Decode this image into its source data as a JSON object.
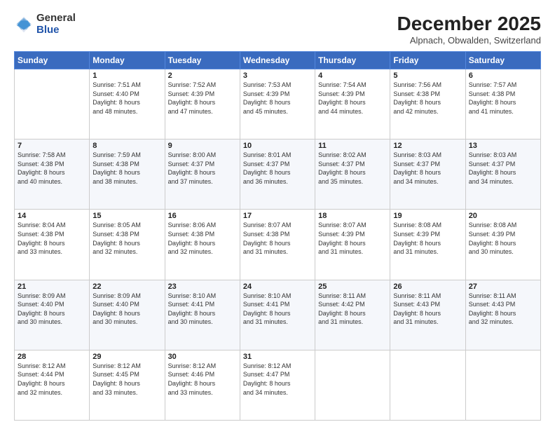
{
  "logo": {
    "general": "General",
    "blue": "Blue"
  },
  "title": "December 2025",
  "subtitle": "Alpnach, Obwalden, Switzerland",
  "weekdays": [
    "Sunday",
    "Monday",
    "Tuesday",
    "Wednesday",
    "Thursday",
    "Friday",
    "Saturday"
  ],
  "weeks": [
    [
      {
        "day": "",
        "info": ""
      },
      {
        "day": "1",
        "info": "Sunrise: 7:51 AM\nSunset: 4:40 PM\nDaylight: 8 hours\nand 48 minutes."
      },
      {
        "day": "2",
        "info": "Sunrise: 7:52 AM\nSunset: 4:39 PM\nDaylight: 8 hours\nand 47 minutes."
      },
      {
        "day": "3",
        "info": "Sunrise: 7:53 AM\nSunset: 4:39 PM\nDaylight: 8 hours\nand 45 minutes."
      },
      {
        "day": "4",
        "info": "Sunrise: 7:54 AM\nSunset: 4:39 PM\nDaylight: 8 hours\nand 44 minutes."
      },
      {
        "day": "5",
        "info": "Sunrise: 7:56 AM\nSunset: 4:38 PM\nDaylight: 8 hours\nand 42 minutes."
      },
      {
        "day": "6",
        "info": "Sunrise: 7:57 AM\nSunset: 4:38 PM\nDaylight: 8 hours\nand 41 minutes."
      }
    ],
    [
      {
        "day": "7",
        "info": "Sunrise: 7:58 AM\nSunset: 4:38 PM\nDaylight: 8 hours\nand 40 minutes."
      },
      {
        "day": "8",
        "info": "Sunrise: 7:59 AM\nSunset: 4:38 PM\nDaylight: 8 hours\nand 38 minutes."
      },
      {
        "day": "9",
        "info": "Sunrise: 8:00 AM\nSunset: 4:37 PM\nDaylight: 8 hours\nand 37 minutes."
      },
      {
        "day": "10",
        "info": "Sunrise: 8:01 AM\nSunset: 4:37 PM\nDaylight: 8 hours\nand 36 minutes."
      },
      {
        "day": "11",
        "info": "Sunrise: 8:02 AM\nSunset: 4:37 PM\nDaylight: 8 hours\nand 35 minutes."
      },
      {
        "day": "12",
        "info": "Sunrise: 8:03 AM\nSunset: 4:37 PM\nDaylight: 8 hours\nand 34 minutes."
      },
      {
        "day": "13",
        "info": "Sunrise: 8:03 AM\nSunset: 4:37 PM\nDaylight: 8 hours\nand 34 minutes."
      }
    ],
    [
      {
        "day": "14",
        "info": "Sunrise: 8:04 AM\nSunset: 4:38 PM\nDaylight: 8 hours\nand 33 minutes."
      },
      {
        "day": "15",
        "info": "Sunrise: 8:05 AM\nSunset: 4:38 PM\nDaylight: 8 hours\nand 32 minutes."
      },
      {
        "day": "16",
        "info": "Sunrise: 8:06 AM\nSunset: 4:38 PM\nDaylight: 8 hours\nand 32 minutes."
      },
      {
        "day": "17",
        "info": "Sunrise: 8:07 AM\nSunset: 4:38 PM\nDaylight: 8 hours\nand 31 minutes."
      },
      {
        "day": "18",
        "info": "Sunrise: 8:07 AM\nSunset: 4:39 PM\nDaylight: 8 hours\nand 31 minutes."
      },
      {
        "day": "19",
        "info": "Sunrise: 8:08 AM\nSunset: 4:39 PM\nDaylight: 8 hours\nand 31 minutes."
      },
      {
        "day": "20",
        "info": "Sunrise: 8:08 AM\nSunset: 4:39 PM\nDaylight: 8 hours\nand 30 minutes."
      }
    ],
    [
      {
        "day": "21",
        "info": "Sunrise: 8:09 AM\nSunset: 4:40 PM\nDaylight: 8 hours\nand 30 minutes."
      },
      {
        "day": "22",
        "info": "Sunrise: 8:09 AM\nSunset: 4:40 PM\nDaylight: 8 hours\nand 30 minutes."
      },
      {
        "day": "23",
        "info": "Sunrise: 8:10 AM\nSunset: 4:41 PM\nDaylight: 8 hours\nand 30 minutes."
      },
      {
        "day": "24",
        "info": "Sunrise: 8:10 AM\nSunset: 4:41 PM\nDaylight: 8 hours\nand 31 minutes."
      },
      {
        "day": "25",
        "info": "Sunrise: 8:11 AM\nSunset: 4:42 PM\nDaylight: 8 hours\nand 31 minutes."
      },
      {
        "day": "26",
        "info": "Sunrise: 8:11 AM\nSunset: 4:43 PM\nDaylight: 8 hours\nand 31 minutes."
      },
      {
        "day": "27",
        "info": "Sunrise: 8:11 AM\nSunset: 4:43 PM\nDaylight: 8 hours\nand 32 minutes."
      }
    ],
    [
      {
        "day": "28",
        "info": "Sunrise: 8:12 AM\nSunset: 4:44 PM\nDaylight: 8 hours\nand 32 minutes."
      },
      {
        "day": "29",
        "info": "Sunrise: 8:12 AM\nSunset: 4:45 PM\nDaylight: 8 hours\nand 33 minutes."
      },
      {
        "day": "30",
        "info": "Sunrise: 8:12 AM\nSunset: 4:46 PM\nDaylight: 8 hours\nand 33 minutes."
      },
      {
        "day": "31",
        "info": "Sunrise: 8:12 AM\nSunset: 4:47 PM\nDaylight: 8 hours\nand 34 minutes."
      },
      {
        "day": "",
        "info": ""
      },
      {
        "day": "",
        "info": ""
      },
      {
        "day": "",
        "info": ""
      }
    ]
  ]
}
